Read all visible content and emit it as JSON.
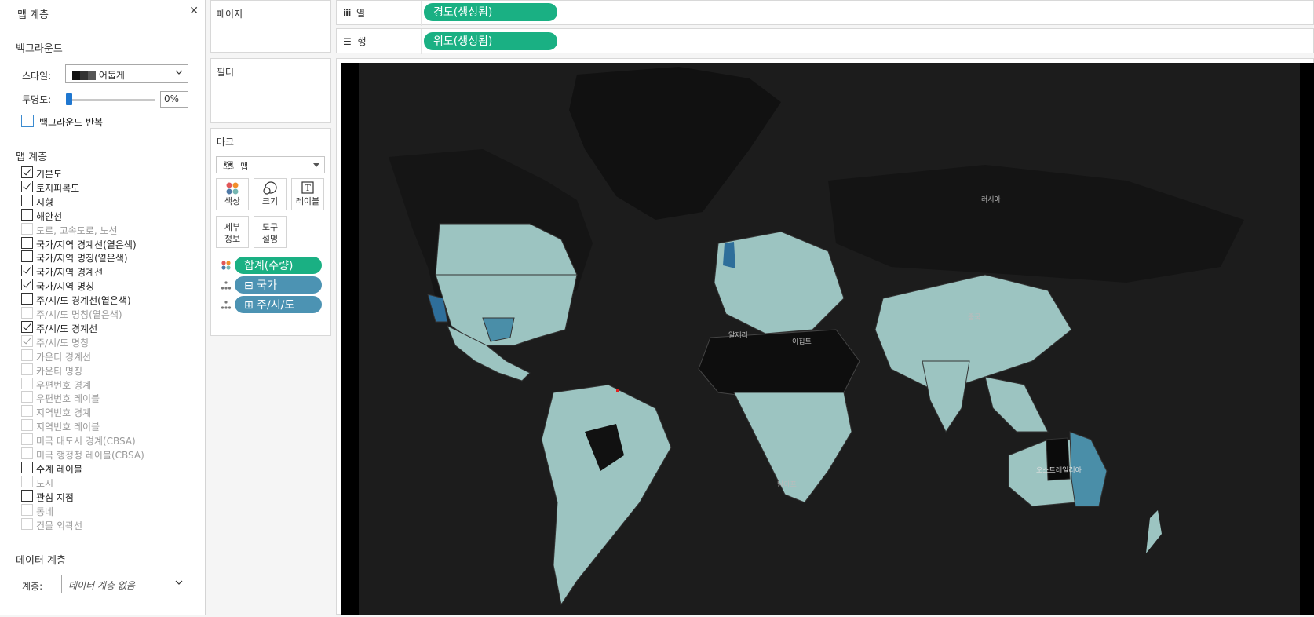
{
  "layers_panel": {
    "title": "맵 계층",
    "close_icon": "close-icon",
    "background": {
      "section_title": "백그라운드",
      "style_label": "스타일:",
      "style_value": "어둡게",
      "opacity_label": "투명도:",
      "opacity_value": "0%",
      "opacity_fraction": 0,
      "repeat_label": "백그라운드 반복"
    },
    "map_layers": {
      "section_title": "맵 계층",
      "items": [
        {
          "label": "기본도",
          "checked": true,
          "enabled": true
        },
        {
          "label": "토지피복도",
          "checked": true,
          "enabled": true
        },
        {
          "label": "지형",
          "checked": false,
          "enabled": true
        },
        {
          "label": "해안선",
          "checked": false,
          "enabled": true
        },
        {
          "label": "도로, 고속도로, 노선",
          "checked": false,
          "enabled": false
        },
        {
          "label": "국가/지역 경계선(옅은색)",
          "checked": false,
          "enabled": true
        },
        {
          "label": "국가/지역 명칭(옅은색)",
          "checked": false,
          "enabled": true
        },
        {
          "label": "국가/지역 경계선",
          "checked": true,
          "enabled": true
        },
        {
          "label": "국가/지역 명칭",
          "checked": true,
          "enabled": true
        },
        {
          "label": "주/시/도 경계선(옅은색)",
          "checked": false,
          "enabled": true
        },
        {
          "label": "주/시/도 명칭(옅은색)",
          "checked": false,
          "enabled": false
        },
        {
          "label": "주/시/도 경계선",
          "checked": true,
          "enabled": true
        },
        {
          "label": "주/시/도 명칭",
          "checked": true,
          "enabled": false
        },
        {
          "label": "카운티 경계선",
          "checked": false,
          "enabled": false
        },
        {
          "label": "카운티 명칭",
          "checked": false,
          "enabled": false
        },
        {
          "label": "우편번호 경계",
          "checked": false,
          "enabled": false
        },
        {
          "label": "우편번호 레이블",
          "checked": false,
          "enabled": false
        },
        {
          "label": "지역번호 경계",
          "checked": false,
          "enabled": false
        },
        {
          "label": "지역번호 레이블",
          "checked": false,
          "enabled": false
        },
        {
          "label": "미국 대도시 경계(CBSA)",
          "checked": false,
          "enabled": false
        },
        {
          "label": "미국 행정청 레이블(CBSA)",
          "checked": false,
          "enabled": false
        },
        {
          "label": "수계 레이블",
          "checked": false,
          "enabled": true
        },
        {
          "label": "도시",
          "checked": false,
          "enabled": false
        },
        {
          "label": "관심 지점",
          "checked": false,
          "enabled": true
        },
        {
          "label": "동네",
          "checked": false,
          "enabled": false
        },
        {
          "label": "건물 외곽선",
          "checked": false,
          "enabled": false
        }
      ]
    },
    "data_layer": {
      "section_title": "데이터 계층",
      "layer_label": "계층:",
      "layer_placeholder": "데이터 계층 없음"
    }
  },
  "cards": {
    "pages_title": "페이지",
    "filters_title": "필터",
    "marks": {
      "title": "마크",
      "type_value": "맵",
      "type_icon": "map-icon",
      "buttons": {
        "color": "색상",
        "size": "크기",
        "label": "레이블",
        "detail_line1": "세부",
        "detail_line2": "정보",
        "tooltip_line1": "도구",
        "tooltip_line2": "설명"
      },
      "pills": [
        {
          "text": "합계(수량)",
          "color": "green",
          "icon": "color-icon"
        },
        {
          "text": "⊟ 국가",
          "color": "blue",
          "icon": "detail-icon"
        },
        {
          "text": "⊞ 주/시/도",
          "color": "blue",
          "icon": "detail-icon"
        }
      ]
    }
  },
  "shelves": {
    "columns_label": "열",
    "columns_icon": "columns-icon",
    "columns_pill": "경도(생성됨)",
    "rows_label": "행",
    "rows_icon": "rows-icon",
    "rows_pill": "위도(생성됨)"
  },
  "map": {
    "background_color": "#000000",
    "land_color": "#1b1b1b",
    "fill_light": "#9cc4c1",
    "fill_mid": "#4a8ea8",
    "fill_dark": "#2e6e9a",
    "labels": {
      "russia": "러시아",
      "algeria": "알제리",
      "egypt": "이집트",
      "china": "중국",
      "australia": "오스트레일리아",
      "south_africa": "남아프"
    }
  },
  "colors": {
    "accent_green": "#1ab083",
    "accent_blue": "#4c93b3",
    "checkbox_blue": "#3b8bd0"
  }
}
